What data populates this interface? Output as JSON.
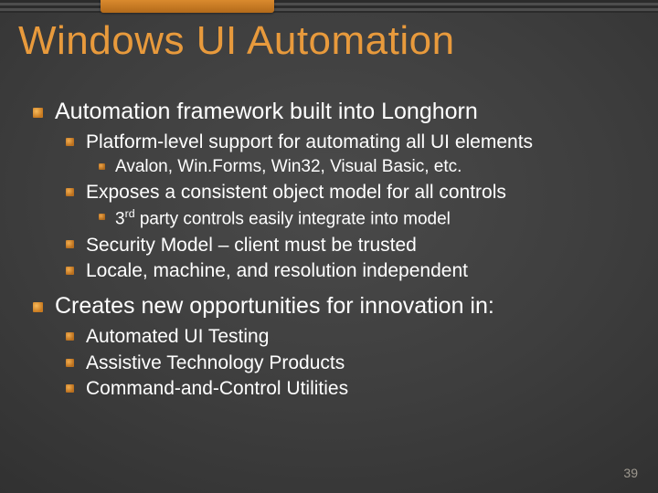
{
  "title": "Windows UI Automation",
  "bullets": {
    "a1": "Automation framework built into Longhorn",
    "a1_b1": "Platform-level support for automating all UI elements",
    "a1_b1_c1": "Avalon, Win.Forms, Win32, Visual Basic, etc.",
    "a1_b2": "Exposes a consistent object model for all controls",
    "a1_b2_c1_pre": "3",
    "a1_b2_c1_sup": "rd",
    "a1_b2_c1_post": " party controls easily integrate into model",
    "a1_b3": "Security Model – client must be trusted",
    "a1_b4": "Locale, machine, and resolution independent",
    "a2": "Creates new opportunities for innovation in:",
    "a2_b1": "Automated UI Testing",
    "a2_b2": "Assistive Technology Products",
    "a2_b3": "Command-and-Control Utilities"
  },
  "page_number": "39"
}
